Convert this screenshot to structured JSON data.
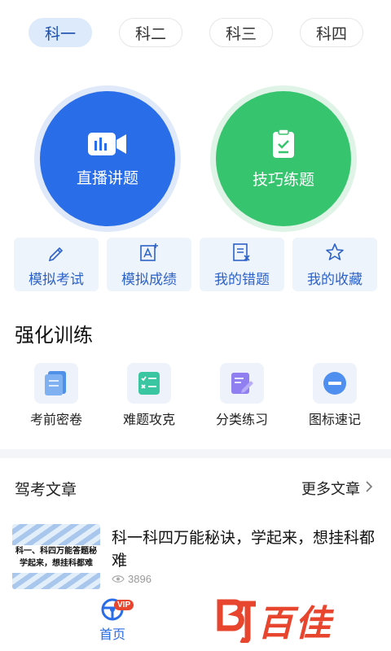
{
  "tabs": [
    {
      "label": "科一",
      "active": true
    },
    {
      "label": "科二",
      "active": false
    },
    {
      "label": "科三",
      "active": false
    },
    {
      "label": "科四",
      "active": false
    }
  ],
  "primary": {
    "live": {
      "label": "直播讲题",
      "icon": "video-camera-icon",
      "color": "#2a6de8"
    },
    "skill": {
      "label": "技巧练题",
      "icon": "checklist-icon",
      "color": "#36c46e"
    }
  },
  "quick": [
    {
      "label": "模拟考试",
      "icon": "pencil-icon"
    },
    {
      "label": "模拟成绩",
      "icon": "score-icon"
    },
    {
      "label": "我的错题",
      "icon": "wrong-list-icon"
    },
    {
      "label": "我的收藏",
      "icon": "star-icon"
    }
  ],
  "training": {
    "title": "强化训练",
    "items": [
      {
        "label": "考前密卷",
        "icon": "scroll-icon"
      },
      {
        "label": "难题攻克",
        "icon": "checklist-icon"
      },
      {
        "label": "分类练习",
        "icon": "edit-icon"
      },
      {
        "label": "图标速记",
        "icon": "minus-circle-icon"
      }
    ]
  },
  "articles": {
    "title": "驾考文章",
    "more": "更多文章",
    "items": [
      {
        "thumb_text_1": "科一、科四万能答题秘",
        "thumb_text_2": "学起来，想挂科都难",
        "title": "科一科四万能秘诀，学起来，想挂科都难",
        "views": "3896"
      }
    ]
  },
  "bottom": {
    "home_label": "首页",
    "vip_badge": "VIP",
    "brand": "百佳"
  },
  "colors": {
    "accent": "#2a6de8",
    "green": "#36c46e",
    "brand_red": "#e8452f"
  }
}
